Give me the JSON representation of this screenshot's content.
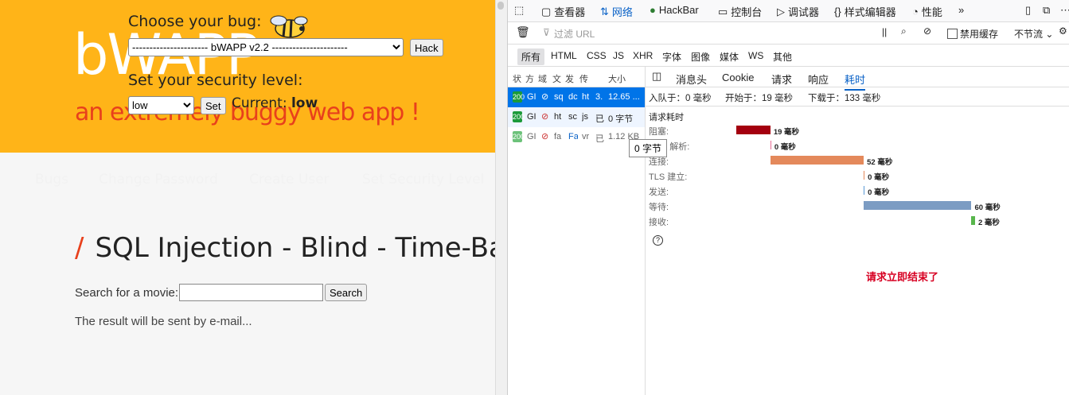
{
  "bwapp": {
    "logo": "bWAPP",
    "tagline": "an extremely buggy web app !",
    "choose_label": "Choose your bug:",
    "bug_select": "---------------------- bWAPP v2.2 ----------------------",
    "hack_button": "Hack",
    "security_label": "Set your security level:",
    "level_select": "low",
    "set_button": "Set",
    "current_label": "Current:",
    "current_value": "low",
    "menu": [
      "Bugs",
      "Change Password",
      "Create User",
      "Set Security Level"
    ],
    "page_title": "SQL Injection - Blind - Time-Based",
    "title_slash": "/",
    "search_label": "Search for a movie:",
    "search_value": "",
    "search_button": "Search",
    "result_text": "The result will be sent by e-mail..."
  },
  "devtools": {
    "tabs": [
      "查看器",
      "网络",
      "HackBar",
      "控制台",
      "调试器",
      "样式编辑器",
      "性能"
    ],
    "filter_placeholder": "过滤 URL",
    "disable_cache": "禁用缓存",
    "throttle": "不节流",
    "types": [
      "所有",
      "HTML",
      "CSS",
      "JS",
      "XHR",
      "字体",
      "图像",
      "媒体",
      "WS",
      "其他"
    ],
    "columns": [
      "状",
      "方",
      "域",
      "文",
      "发",
      "传",
      "大小"
    ],
    "requests": [
      {
        "status": "200",
        "method": "GI",
        "file": "sq",
        "domain": "dc",
        "type": "ht",
        "transferred": "3.",
        "size": "12.65 ..."
      },
      {
        "status": "200",
        "method": "GI",
        "file": "ht",
        "domain": "sc",
        "type": "js",
        "transferred": "已",
        "size": "0 字节"
      },
      {
        "status": "200",
        "method": "GI",
        "file": "fa",
        "domain": "Fa",
        "type": "vr",
        "transferred": "已",
        "size": "1.12 KB"
      }
    ],
    "tooltip": "0 字节",
    "detail_tabs": [
      "消息头",
      "Cookie",
      "请求",
      "响应",
      "耗时"
    ],
    "summary": {
      "queued": "入队于：0 毫秒",
      "started": "开始于：19 毫秒",
      "downloaded": "下载于：133 毫秒"
    },
    "timing_title": "请求耗时",
    "timings": [
      {
        "label": "阻塞:",
        "value": "19 毫秒",
        "start": 0,
        "duration": 19,
        "color": "#a4000f"
      },
      {
        "label": "DNS 解析:",
        "value": "0 毫秒",
        "start": 19,
        "duration": 0,
        "color": "#e86d96"
      },
      {
        "label": "连接:",
        "value": "52 毫秒",
        "start": 19,
        "duration": 52,
        "color": "#e4895b"
      },
      {
        "label": "TLS 建立:",
        "value": "0 毫秒",
        "start": 71,
        "duration": 0,
        "color": "#e4895b"
      },
      {
        "label": "发送:",
        "value": "0 毫秒",
        "start": 71,
        "duration": 0,
        "color": "#5b9ad6"
      },
      {
        "label": "等待:",
        "value": "60 毫秒",
        "start": 71,
        "duration": 60,
        "color": "#7c9cc3"
      },
      {
        "label": "接收:",
        "value": "2 毫秒",
        "start": 131,
        "duration": 2,
        "color": "#58b64c"
      }
    ],
    "finish_message": "请求立即结束了"
  }
}
